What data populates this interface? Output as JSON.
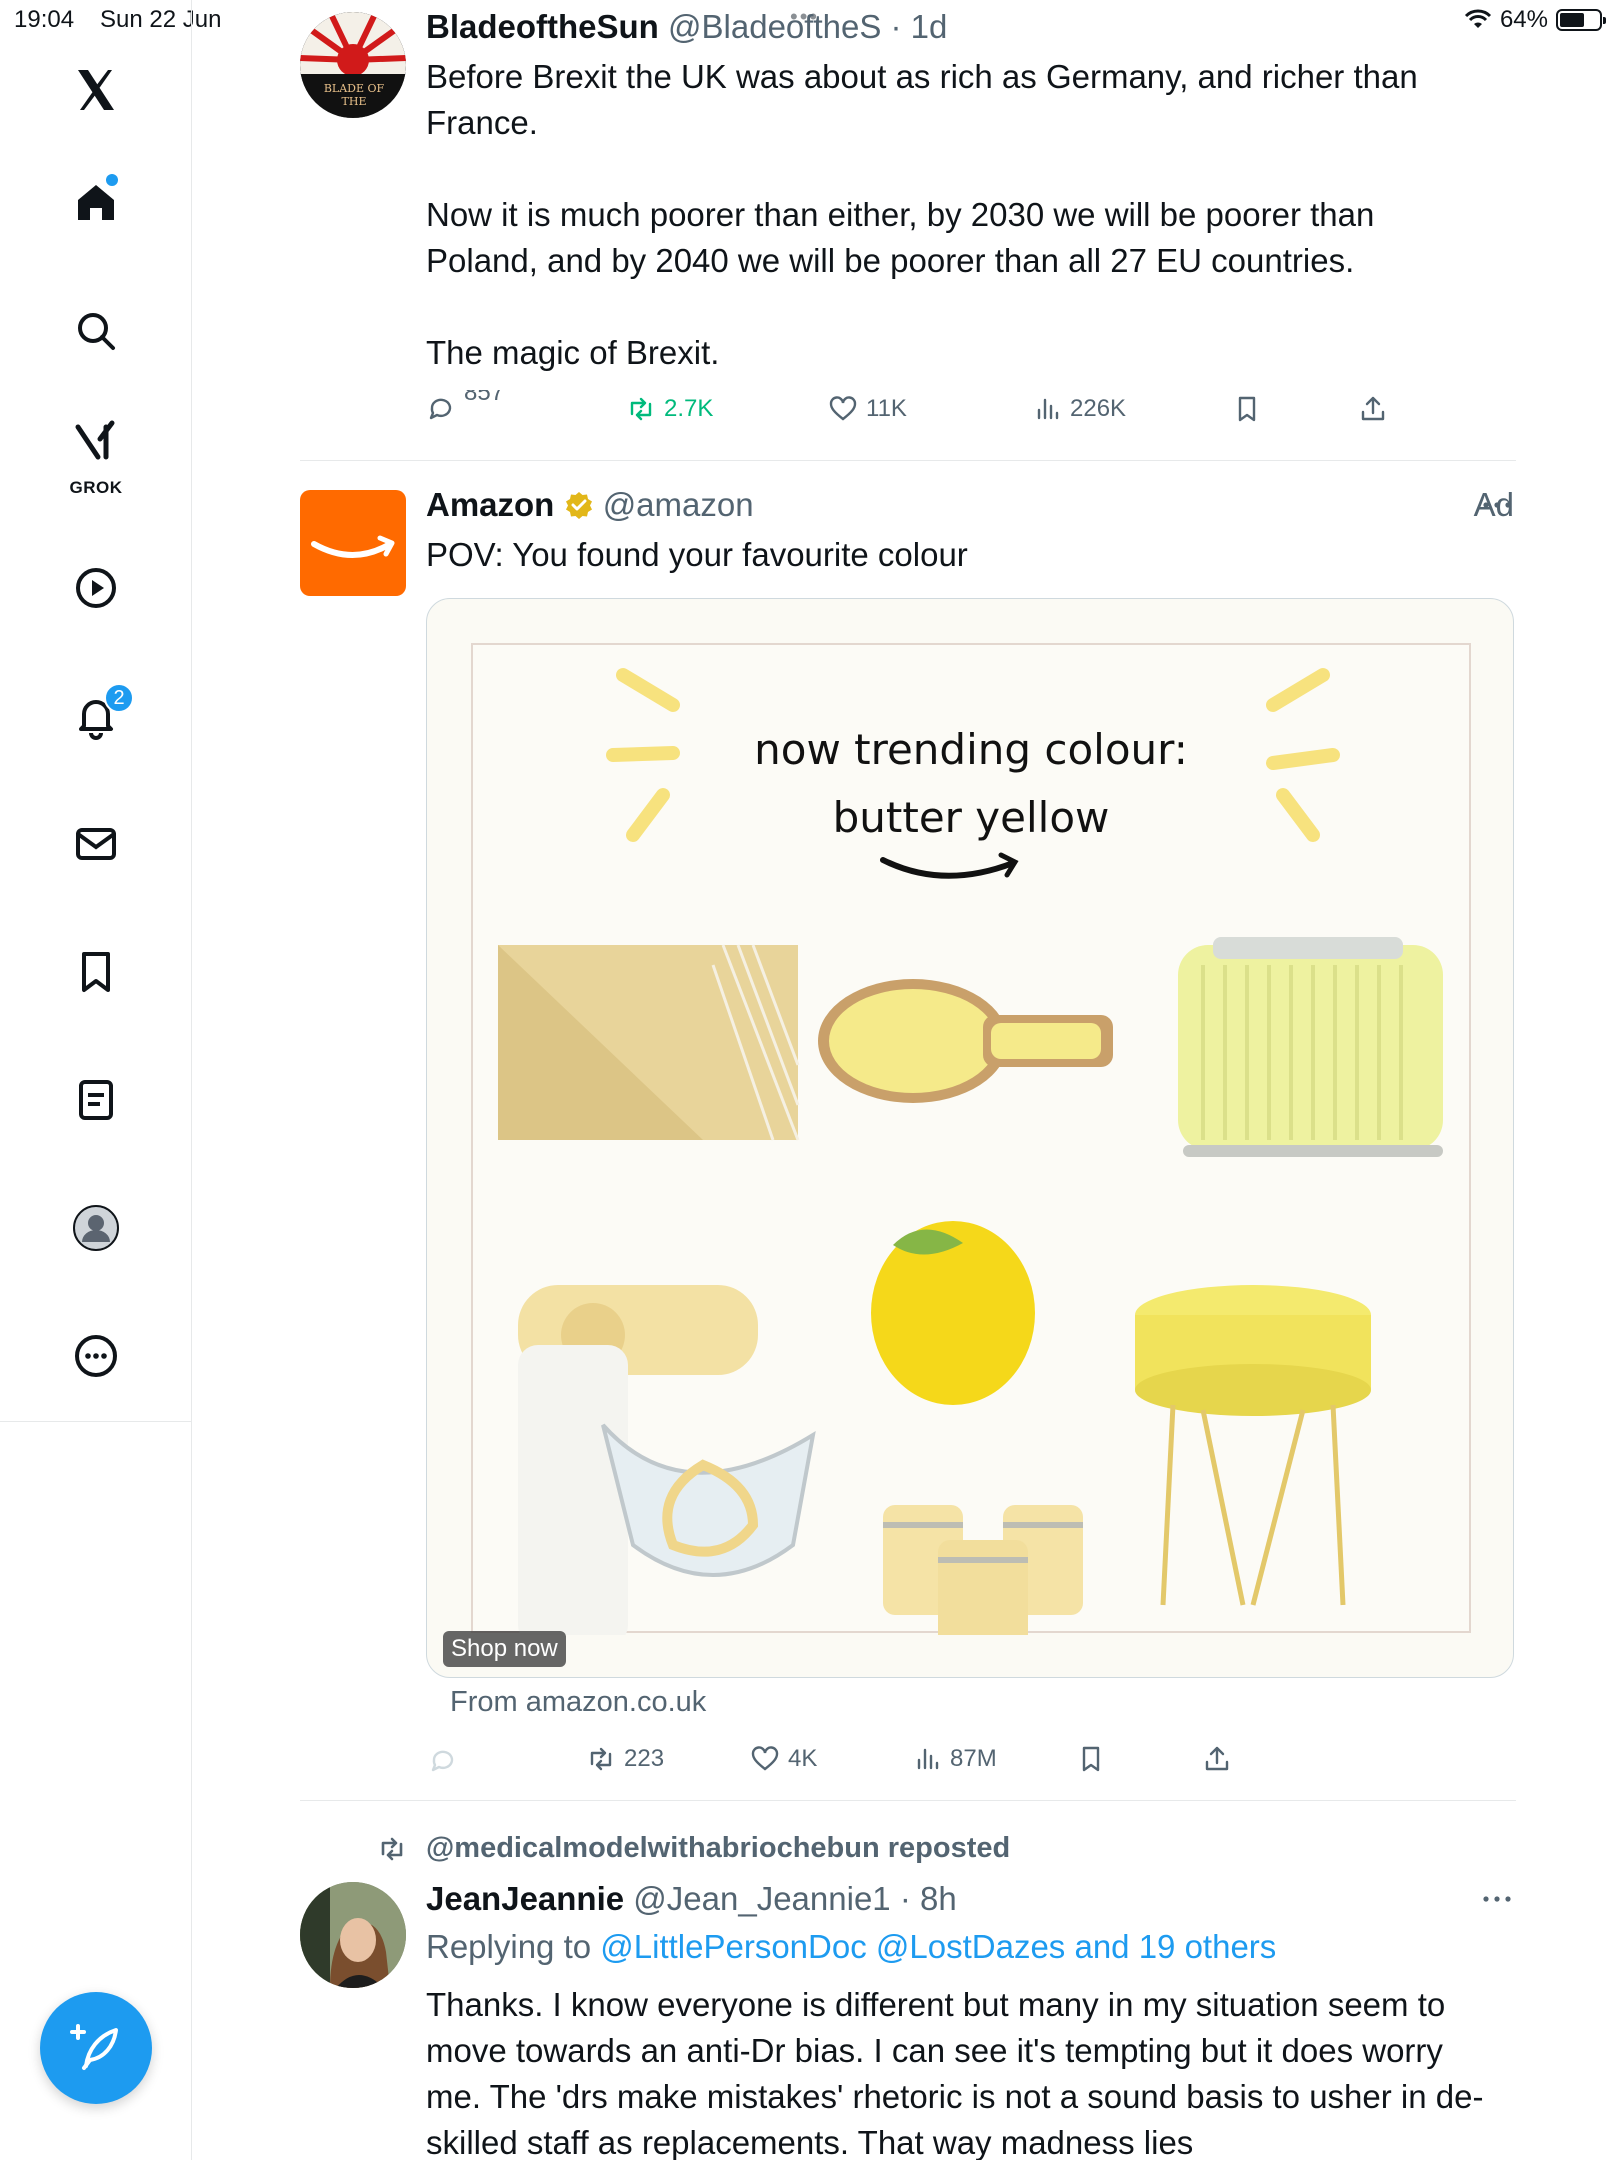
{
  "status_bar": {
    "time": "19:04",
    "date": "Sun 22 Jun",
    "battery": "64%"
  },
  "sidebar": {
    "notifications_badge": "2",
    "grok_label": "GROK"
  },
  "tweet1": {
    "name": "BladeoftheSun",
    "handle": "@BladeoftheS",
    "time": "· 1d",
    "avatar_text": "BLADE OF THE",
    "body": "Before Brexit the UK was about as rich as Germany, and richer than France.\n\nNow it is much poorer than either, by 2030 we will be poorer than Poland, and by 2040 we will be poorer than all 27 EU countries.\n\nThe magic of Brexit.",
    "replies": "857",
    "reposts": "2.7K",
    "likes": "11K",
    "views": "226K"
  },
  "ad": {
    "name": "Amazon",
    "handle": "@amazon",
    "ad_label": "Ad",
    "text": "POV: You found your favourite colour",
    "image_title_line1": "now trending colour:",
    "image_title_line2": "butter yellow",
    "shop_now": "Shop now",
    "from": "From amazon.co.uk",
    "reposts": "223",
    "likes": "4K",
    "views": "87M"
  },
  "tweet3": {
    "reposted_by": "@medicalmodelwithabriochebun reposted",
    "name": "JeanJeannie",
    "handle": "@Jean_Jeannie1",
    "time": "· 8h",
    "replying_prefix": "Replying to ",
    "replying_to": "@LittlePersonDoc @LostDazes and 19 others",
    "body": "Thanks. I know everyone is different but many in my situation seem to move towards an anti-Dr bias. I can see it's tempting but it does worry me. The 'drs make mistakes' rhetoric is not a sound basis to usher in de-skilled staff as replacements. That way madness lies"
  },
  "colors": {
    "accent": "#1d9bf0",
    "repost_green": "#00ba7c",
    "amazon_orange": "#ff6a00",
    "muted": "#536471"
  }
}
